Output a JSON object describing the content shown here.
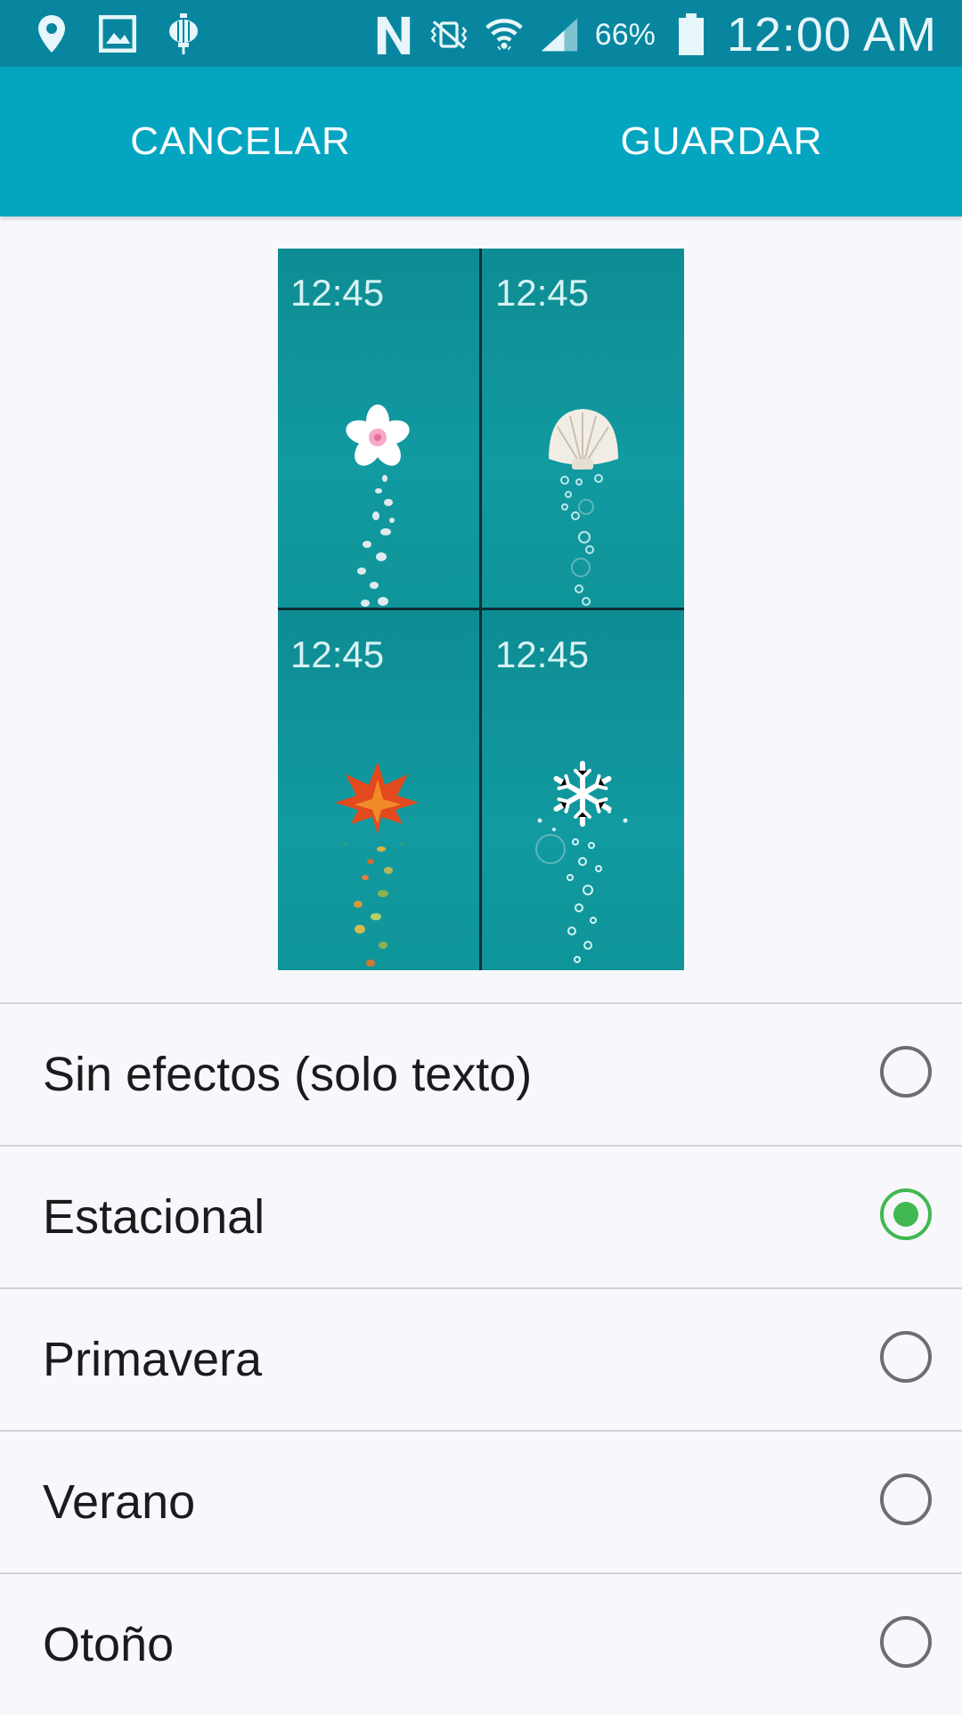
{
  "status_bar": {
    "battery": "66%",
    "time": "12:00 AM",
    "icons_left": [
      "location-icon",
      "image-icon",
      "lantern-icon"
    ],
    "icons_right": [
      "nfc-icon",
      "vibrate-icon",
      "wifi-icon",
      "signal-icon",
      "battery-icon"
    ]
  },
  "action_bar": {
    "cancel_label": "CANCELAR",
    "save_label": "GUARDAR"
  },
  "preview": {
    "tiles": [
      {
        "time": "12:45",
        "art": "sakura-flower"
      },
      {
        "time": "12:45",
        "art": "seashell"
      },
      {
        "time": "12:45",
        "art": "maple-leaf"
      },
      {
        "time": "12:45",
        "art": "snowflake"
      }
    ]
  },
  "options": [
    {
      "label": "Sin efectos (solo texto)",
      "selected": false
    },
    {
      "label": "Estacional",
      "selected": true
    },
    {
      "label": "Primavera",
      "selected": false
    },
    {
      "label": "Verano",
      "selected": false
    },
    {
      "label": "Otoño",
      "selected": false
    }
  ],
  "colors": {
    "status_bar": "#0886a0",
    "action_bar": "#04a5c1",
    "radio_selected": "#3fb851",
    "radio_unselected": "#6e6e72"
  }
}
